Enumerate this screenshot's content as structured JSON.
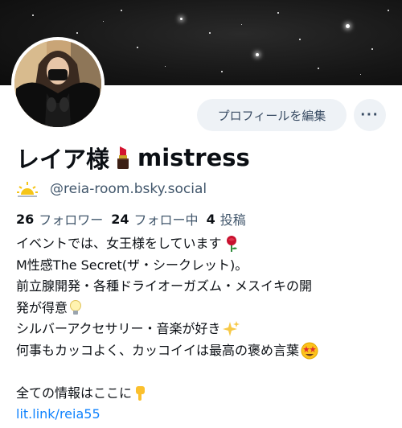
{
  "profile": {
    "display_name": "レイア様",
    "name_suffix": "mistress",
    "handle": "@reia-room.bsky.social",
    "edit_button": "プロフィールを編集",
    "more_button": "···",
    "banner_icon": "starfield-banner",
    "avatar_icon": "avatar-photo"
  },
  "stats": {
    "followers_count": "26",
    "followers_label": "フォロワー",
    "following_count": "24",
    "following_label": "フォロー中",
    "posts_count": "4",
    "posts_label": "投稿"
  },
  "bio": {
    "line1": "イベントでは、女王様をしています",
    "line2": "M性感The Secret(ザ・シークレット)。",
    "line3": "前立腺開発・各種ドライオーガズム・メスイキの開",
    "line4": "発が得意",
    "line5": "シルバーアクセサリー・音楽が好き",
    "line6": "何事もカッコよく、カッコイイは最高の褒め言葉",
    "line7": "全ての情報はここに",
    "link": "lit.link/reia55"
  },
  "icons": [
    "lipstick-icon",
    "sun-icon",
    "rose-icon",
    "lightbulb-icon",
    "sparkles-icon",
    "star-struck-icon",
    "pointing-down-icon",
    "more-icon"
  ],
  "colors": {
    "accent_link": "#1083fe",
    "muted_text": "#42576c",
    "button_bg": "#eef2f6"
  }
}
